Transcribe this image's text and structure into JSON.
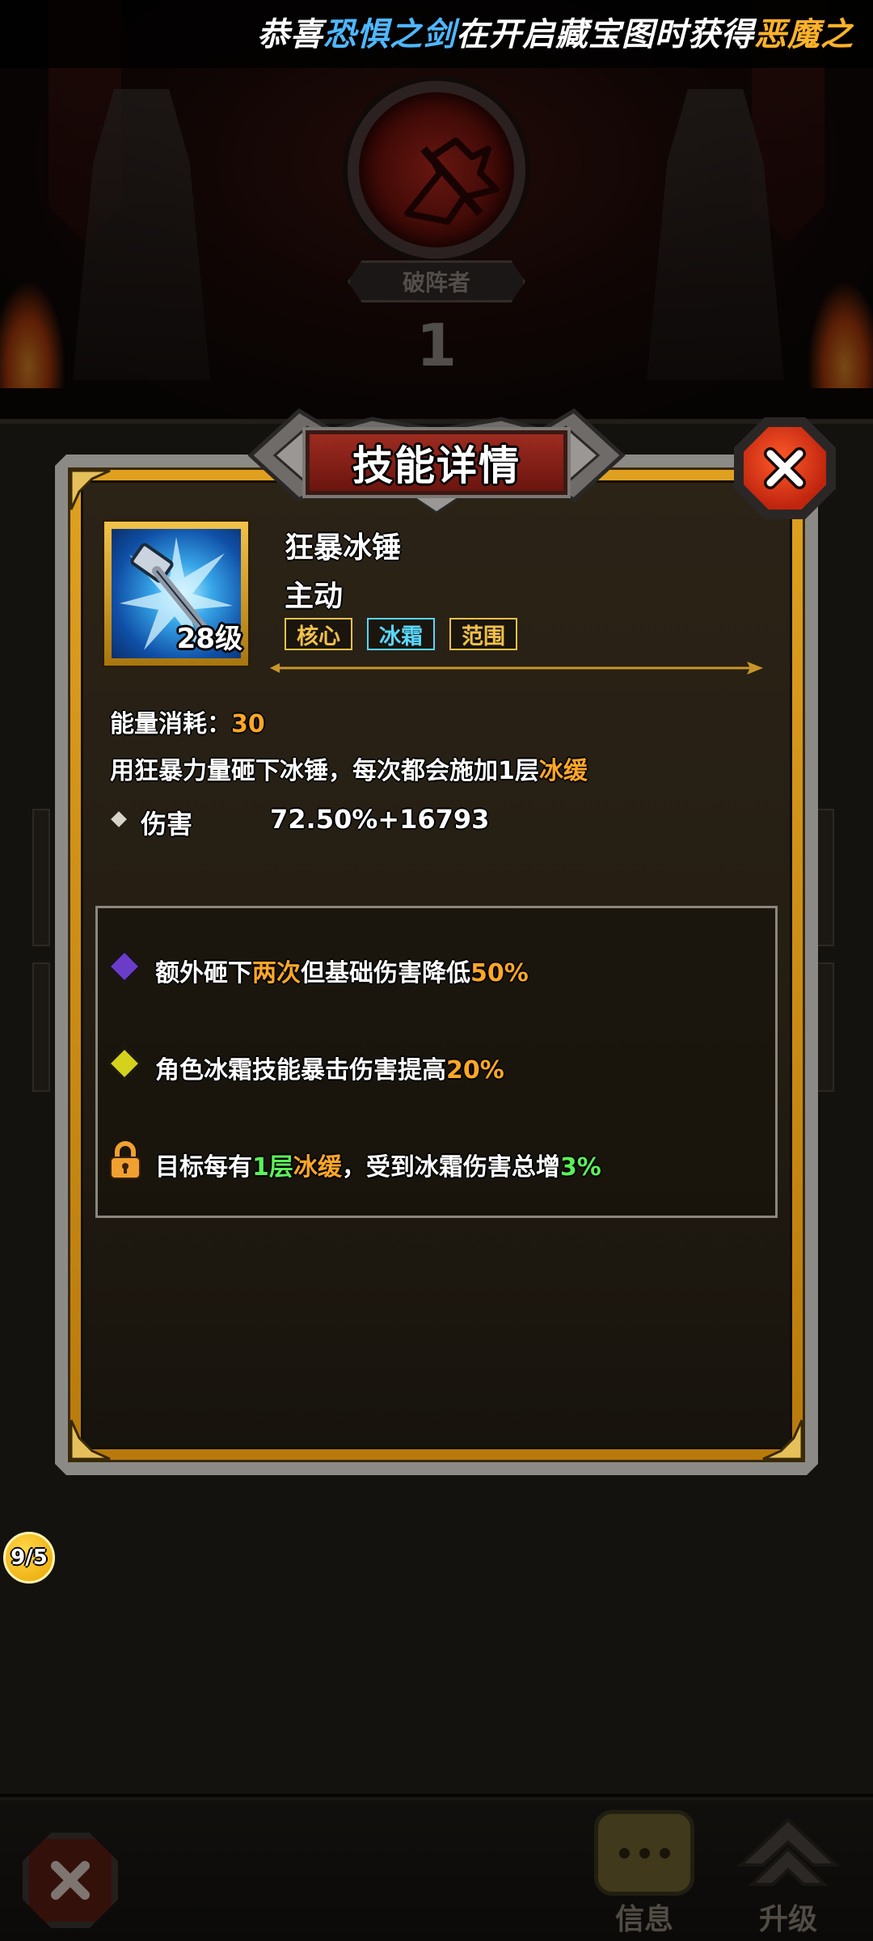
{
  "notice": {
    "part1": "恭喜",
    "item": "恐惧之剑",
    "part2": "在开启藏宝图时获得",
    "reward": "恶魔之"
  },
  "background": {
    "hero_title": "破阵者",
    "hero_level": "1"
  },
  "modal": {
    "title": "技能详情",
    "skill": {
      "name": "狂暴冰锤",
      "type": "主动",
      "level": "28级",
      "tags": [
        {
          "label": "核心",
          "color": "#f2c14a"
        },
        {
          "label": "冰霜",
          "color": "#5ad6ff"
        },
        {
          "label": "范围",
          "color": "#f2c14a"
        }
      ]
    },
    "cost_label": "能量消耗：",
    "cost_value": "30",
    "description": {
      "text": "用狂暴力量砸下冰锤，每次都会施加1层",
      "highlight": "冰缓"
    },
    "damage": {
      "label": "伤害",
      "value": "72.50%+16793"
    },
    "traits": [
      {
        "icon": "purple-gem-icon",
        "gem_color": "#6a3cc8",
        "p1": "额外砸下",
        "h1": "两次",
        "p2": "但基础伤害降低",
        "h2": "50%"
      },
      {
        "icon": "yellow-gem-icon",
        "gem_color": "#d4d21c",
        "p1": "角色冰霜技能暴击伤害提高",
        "h1": "20%"
      },
      {
        "icon": "lock-icon",
        "p1": "目标每有",
        "h1": "1层",
        "h1b": "冰缓",
        "p2": "，受到冰霜伤害总增",
        "h2": "3%"
      }
    ]
  },
  "side_badge": "9/5",
  "bottom_nav": {
    "info_label": "信息",
    "upgrade_label": "升级"
  }
}
